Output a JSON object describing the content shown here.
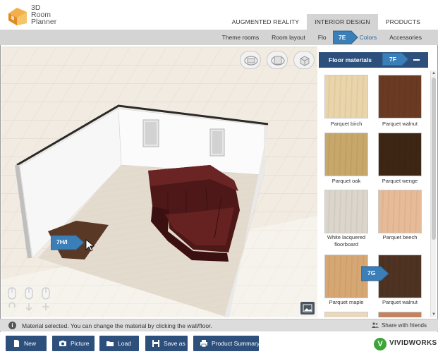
{
  "app": {
    "logo_lines": [
      "3D",
      "Room",
      "Planner"
    ]
  },
  "main_nav": [
    {
      "label": "AUGMENTED REALITY",
      "active": false
    },
    {
      "label": "INTERIOR DESIGN",
      "active": true
    },
    {
      "label": "PRODUCTS",
      "active": false
    }
  ],
  "sub_nav": [
    {
      "label": "Theme rooms"
    },
    {
      "label": "Room layout"
    },
    {
      "label": "Flo"
    },
    {
      "label": "Colors"
    },
    {
      "label": "Accessories"
    }
  ],
  "panel": {
    "title": "Floor materials",
    "materials": [
      {
        "label": "Parquet birch",
        "color": "#ead4aa"
      },
      {
        "label": "Parquet walnut",
        "color": "#6b3a22"
      },
      {
        "label": "Parquet oak",
        "color": "#c7a86a"
      },
      {
        "label": "Parquet wenge",
        "color": "#3e2614"
      },
      {
        "label": "White lacquered floorboard",
        "color": "#dcd5cc"
      },
      {
        "label": "Parquet beech",
        "color": "#e8bb98"
      },
      {
        "label": "Parquet maple",
        "color": "#d6a773"
      },
      {
        "label": "Parquet walnut",
        "color": "#4e3222"
      }
    ]
  },
  "callouts": {
    "c7e": "7E",
    "c7f": "7F",
    "c7hi": "7H/I",
    "c7g": "7G"
  },
  "status": {
    "message": "Material selected. You can change the material by clicking the wall/floor.",
    "share_label": "Share with friends",
    "info_icon": "i"
  },
  "toolbar": [
    {
      "label": "New",
      "icon": "new-file-icon"
    },
    {
      "label": "Picture",
      "icon": "camera-icon"
    },
    {
      "label": "Load",
      "icon": "folder-icon"
    },
    {
      "label": "Save as",
      "icon": "save-icon"
    },
    {
      "label": "Product Summary",
      "icon": "print-icon"
    }
  ],
  "brand": {
    "mark": "V",
    "name": "VIVIDWORKS"
  },
  "colors": {
    "accent": "#2c4f7c",
    "active_link": "#2f6aa7",
    "sofa": "#5c1f1f",
    "floor": "#e6ded3",
    "selected_floor_patch": "#5a3826",
    "brand_green": "#3da43a"
  }
}
